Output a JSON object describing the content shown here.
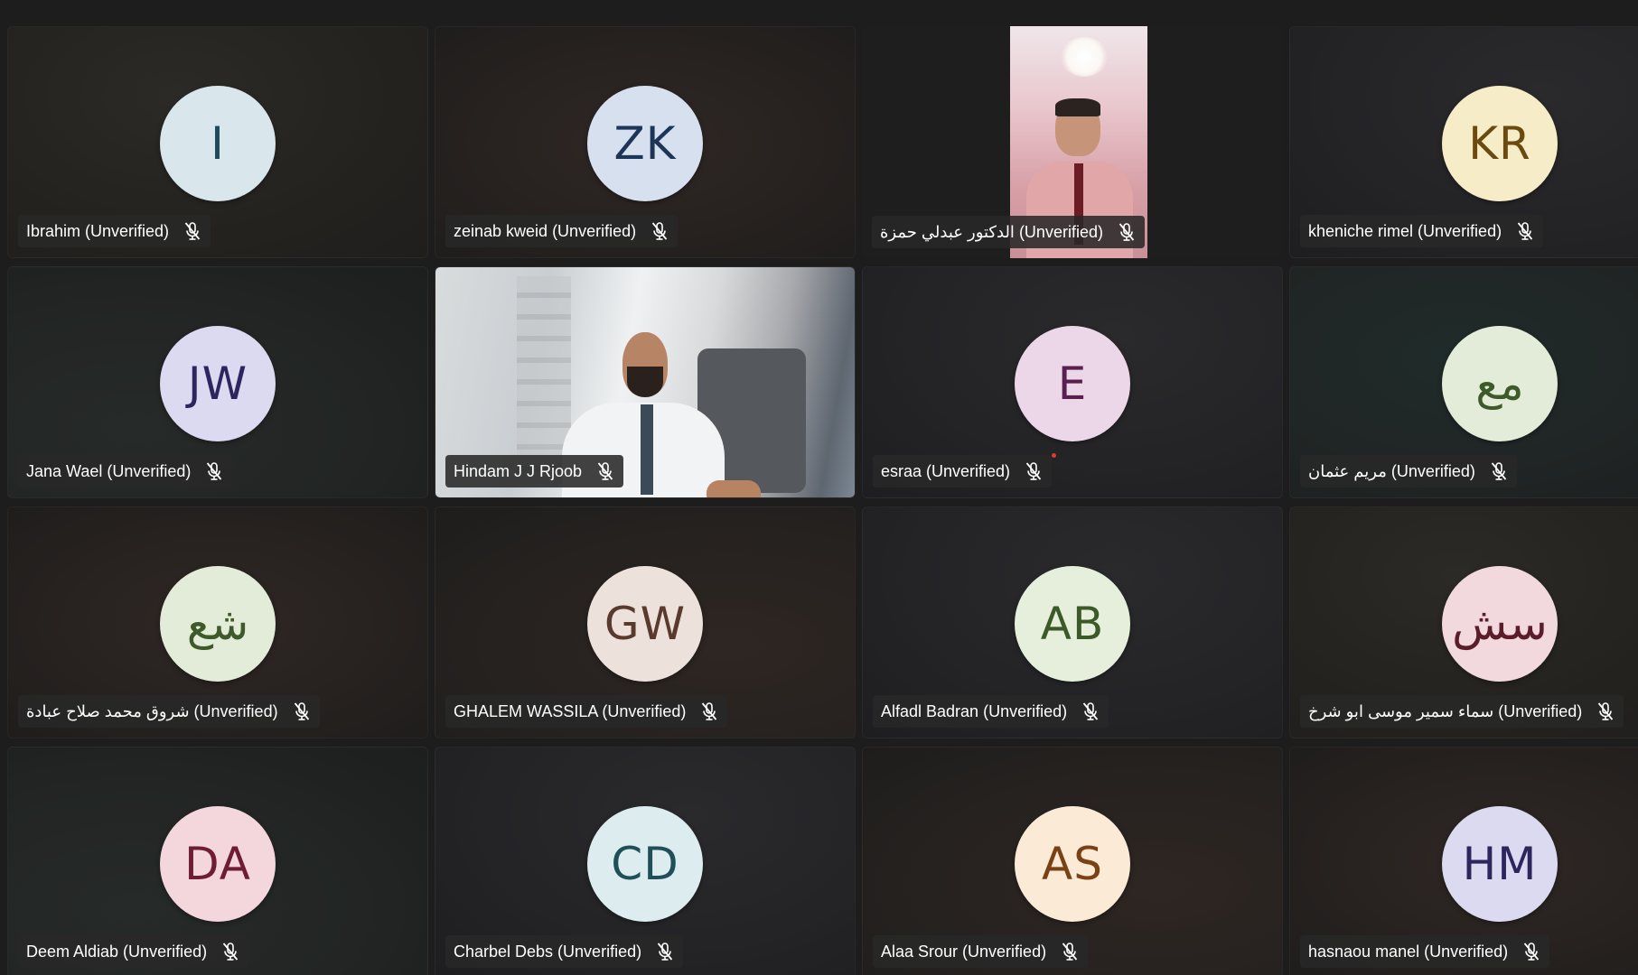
{
  "participants": [
    {
      "name": "Ibrahim (Unverified)",
      "initials": "I",
      "avatar_bg": "#d9e6ec",
      "avatar_fg": "#1f4a5a",
      "muted": true
    },
    {
      "name": "zeinab kweid (Unverified)",
      "initials": "ZK",
      "avatar_bg": "#d6e0ee",
      "avatar_fg": "#1d3557",
      "muted": true
    },
    {
      "name": "الدكتور عبدلي حمزة (Unverified)",
      "initials": "",
      "video": "portrait",
      "muted": true
    },
    {
      "name": "kheniche rimel (Unverified)",
      "initials": "KR",
      "avatar_bg": "#f7ecc8",
      "avatar_fg": "#6b4a10",
      "muted": true
    },
    {
      "name": "Jana Wael (Unverified)",
      "initials": "JW",
      "avatar_bg": "#dcdaf0",
      "avatar_fg": "#2b275e",
      "muted": true
    },
    {
      "name": "Hindam J J Rjoob",
      "initials": "",
      "video": "office",
      "muted": true
    },
    {
      "name": "esraa (Unverified)",
      "initials": "E",
      "avatar_bg": "#ecd7e8",
      "avatar_fg": "#5a1f4e",
      "muted": true,
      "speaking_dot": true
    },
    {
      "name": "مريم عثمان (Unverified)",
      "initials": "مع",
      "avatar_bg": "#e3ebd9",
      "avatar_fg": "#3e5a2a",
      "muted": true
    },
    {
      "name": "شروق محمد صلاح عبادة (Unverified)",
      "initials": "شع",
      "avatar_bg": "#e3ebd9",
      "avatar_fg": "#3e5a2a",
      "muted": true
    },
    {
      "name": "GHALEM WASSILA (Unverified)",
      "initials": "GW",
      "avatar_bg": "#ede1dc",
      "avatar_fg": "#5a3a2c",
      "muted": true
    },
    {
      "name": "Alfadl Badran (Unverified)",
      "initials": "AB",
      "avatar_bg": "#e5efdb",
      "avatar_fg": "#3c5a27",
      "muted": true
    },
    {
      "name": "سماء سمير موسى ابو شرخ (Unverified)",
      "initials": "سش",
      "avatar_bg": "#f1d9de",
      "avatar_fg": "#5c1d2b",
      "muted": true
    },
    {
      "name": "Deem Aldiab (Unverified)",
      "initials": "DA",
      "avatar_bg": "#f4d6dd",
      "avatar_fg": "#6e1d34",
      "muted": true
    },
    {
      "name": "Charbel Debs (Unverified)",
      "initials": "CD",
      "avatar_bg": "#dcecef",
      "avatar_fg": "#1f5058",
      "muted": true
    },
    {
      "name": "Alaa Srour (Unverified)",
      "initials": "AS",
      "avatar_bg": "#faead6",
      "avatar_fg": "#7a4214",
      "muted": true
    },
    {
      "name": "hasnaou manel (Unverified)",
      "initials": "HM",
      "avatar_bg": "#dcdaf0",
      "avatar_fg": "#2b275e",
      "muted": true
    }
  ],
  "icons": {
    "muted": "mic-off-icon"
  }
}
